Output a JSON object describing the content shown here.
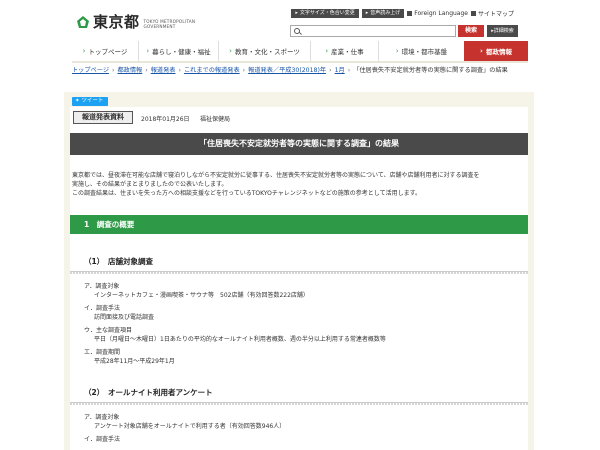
{
  "header": {
    "logo_jp": "東京都",
    "logo_en_line1": "TOKYO METROPOLITAN",
    "logo_en_line2": "GOVERNMENT",
    "util": {
      "text_size": "文字サイズ・色合い変更",
      "read_aloud": "音声読み上げ",
      "foreign_language": "Foreign Language",
      "sitemap": "サイトマップ"
    },
    "search": {
      "placeholder": "",
      "button": "検索",
      "advanced": "詳細検索"
    }
  },
  "gnav": [
    {
      "label": "トップページ"
    },
    {
      "label": "暮らし・健康・福祉"
    },
    {
      "label": "教育・文化・スポーツ"
    },
    {
      "label": "産業・仕事"
    },
    {
      "label": "環境・都市基盤"
    },
    {
      "label": "都政情報"
    }
  ],
  "breadcrumb": {
    "items": [
      "トップページ",
      "都政情報",
      "報道発表",
      "これまでの報道発表",
      "報道発表／平成30(2018)年",
      "1月"
    ],
    "current": "「住居喪失不安定就労者等の実態に関する調査」の結果"
  },
  "tweet_label": "ツイート",
  "press": {
    "badge": "報道発表資料",
    "date": "2018年01月26日",
    "bureau": "福祉保健局"
  },
  "title": "「住居喪失不安定就労者等の実態に関する調査」の結果",
  "intro": {
    "line1": "東京都では、昼夜滞在可能な店舗で寝泊りしながら不安定就労に従事する、住居喪失不安定就労者等の実態について、店舗や店舗利用者に対する調査を",
    "line2": "実施し、その結果がまとまりましたので公表いたします。",
    "line3": "この調査結果は、住まいを失った方への相談支援などを行っているTOKYOチャレンジネットなどの施策の参考として活用します。"
  },
  "section1": {
    "heading": "1　調査の概要",
    "sub1": {
      "heading": "（1）　店舗対象調査",
      "items": [
        {
          "label": "ア．調査対象",
          "value": "インターネットカフェ・漫画喫茶・サウナ等　502店舗（有効回答数222店舗）"
        },
        {
          "label": "イ．調査手法",
          "value": "訪問面接及び電話調査"
        },
        {
          "label": "ウ．主な調査項目",
          "value": "平日（月曜日～木曜日）1日あたりの平均的なオールナイト利用者概数、週の半分以上利用する常連者概数等"
        },
        {
          "label": "エ．調査期間",
          "value": "平成28年11月～平成29年1月"
        }
      ]
    },
    "sub2": {
      "heading": "（2）　オールナイト利用者アンケート",
      "items": [
        {
          "label": "ア．調査対象",
          "value": "アンケート対象店舗をオールナイトで利用する者（有効回答数946人）"
        },
        {
          "label": "イ．調査手法",
          "value": ""
        }
      ]
    }
  },
  "colors": {
    "green": "#2e9a48",
    "red": "#c6332e",
    "dark": "#4a4a4a",
    "link": "#1a56a8"
  }
}
